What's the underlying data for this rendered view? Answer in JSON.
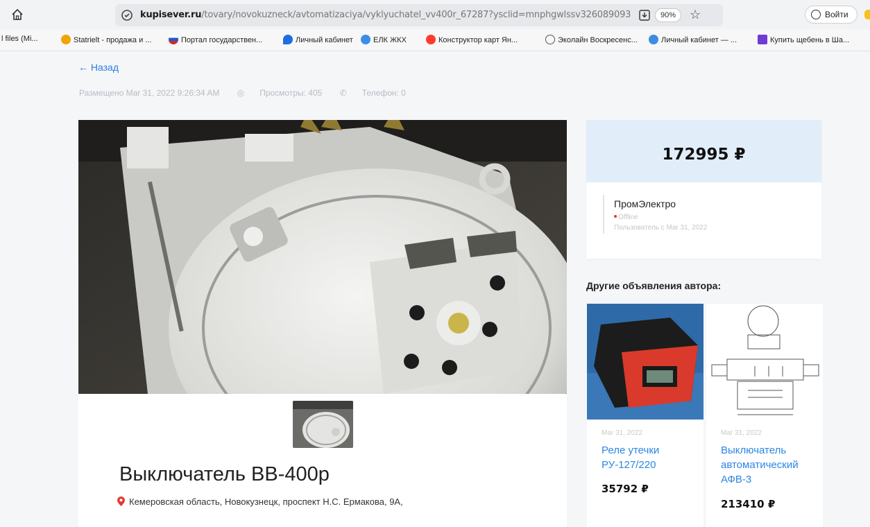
{
  "browser": {
    "url_host": "kupisever.ru",
    "url_path": "/tovary/novokuzneck/avtomatizaciya/vyklyuchatel_vv400r_67287?ysclid=mnphgwlssv326089093",
    "zoom": "90%",
    "login_label": "Войти",
    "bookmarks": [
      {
        "label": "l files (Mi...",
        "icon": "file-icon",
        "color": "#666666"
      },
      {
        "label": "Statrielt - продажа и ...",
        "icon": "statrielt-icon",
        "color": "#f0a500"
      },
      {
        "label": "Портал государствен...",
        "icon": "gosuslugi-icon",
        "color": "#1f5bd1"
      },
      {
        "label": "Личный кабинет",
        "icon": "drop-icon",
        "color": "#1d6fe0"
      },
      {
        "label": "ЕЛК ЖКХ",
        "icon": "elk-icon",
        "color": "#3a8ee6"
      },
      {
        "label": "Конструктор карт Ян...",
        "icon": "map-pin-icon",
        "color": "#ff3b30"
      },
      {
        "label": "Эколайн Воскресенс...",
        "icon": "globe-icon",
        "color": "#555555"
      },
      {
        "label": "Личный кабинет — ...",
        "icon": "account-icon",
        "color": "#3b8de0"
      },
      {
        "label": "Купить щебень в Ша...",
        "icon": "play-icon",
        "color": "#6f3bd4"
      }
    ]
  },
  "page": {
    "back_label": "← Назад",
    "posted": "Размещено Mar 31, 2022 9:26:34 AM",
    "views": "Просмотры: 405",
    "phone": "Телефон: 0",
    "title": "Выключатель ВВ-400р",
    "location": "Кемеровская область, Новокузнецк, проспект Н.С. Ермакова, 9А,"
  },
  "sidebar": {
    "price": "172995 ₽",
    "seller_name": "ПромЭлектро",
    "seller_status": "Offline",
    "seller_since": "Пользователь с Mar 31, 2022",
    "other_title": "Другие объявления автора:",
    "ads": [
      {
        "date": "Mar 31, 2022",
        "name": "Реле утечки РУ-127/220",
        "price": "35792 ₽"
      },
      {
        "date": "Mar 31, 2022",
        "name": "Выключатель автоматический АФВ-3",
        "price": "213410 ₽"
      }
    ]
  },
  "colors": {
    "accent": "#2b7de0",
    "price_band": "#e1eefa",
    "location_pin": "#e53935"
  }
}
